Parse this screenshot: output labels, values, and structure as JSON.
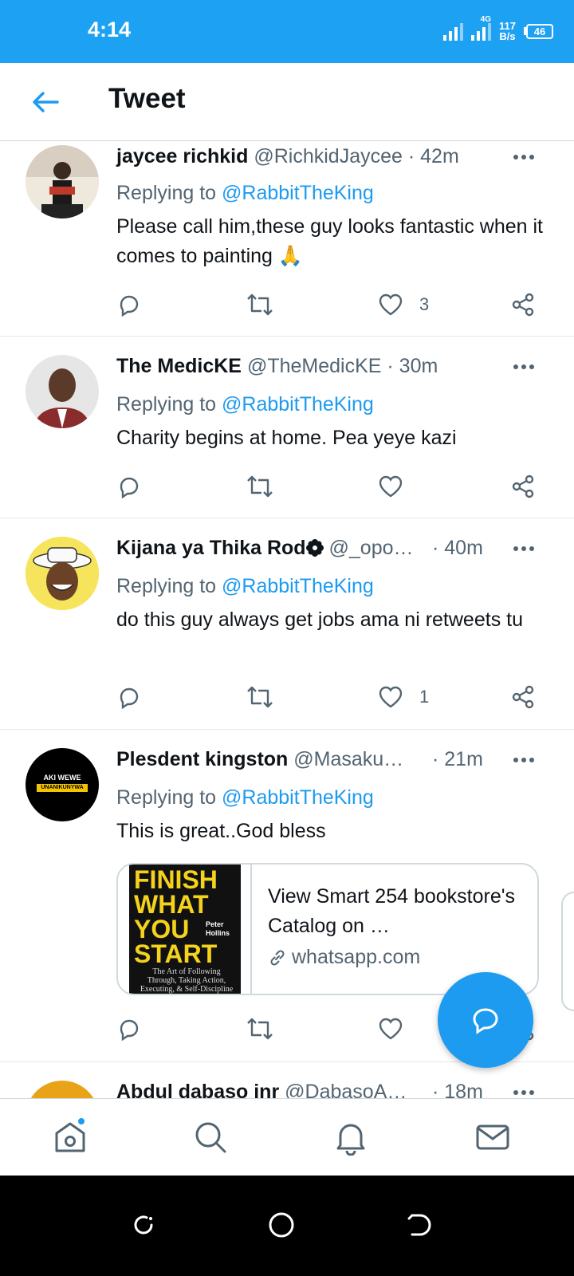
{
  "status_bar": {
    "time": "4:14",
    "network_type": "4G",
    "net_speed_value": "117",
    "net_speed_unit": "B/s",
    "battery": "46"
  },
  "header": {
    "title": "Tweet",
    "back_icon": "arrow-left-icon"
  },
  "colors": {
    "brand": "#1da1f2",
    "link": "#1d9bf0",
    "muted": "#536471",
    "text": "#0f1419"
  },
  "tweets": [
    {
      "name": "jaycee richkid",
      "handle": "@RichkidJaycee",
      "time": "42m",
      "reply_prefix": "Replying to",
      "reply_to": "@RabbitTheKing",
      "text": "Please call him,these guy looks fantastic when it comes to painting 🙏",
      "like_count": "3"
    },
    {
      "name": "The MedicKE",
      "handle": "@TheMedicKE",
      "time": "30m",
      "reply_prefix": "Replying to",
      "reply_to": "@RabbitTheKing",
      "text": "Charity begins at home. Pea yeye kazi",
      "like_count": ""
    },
    {
      "name": "Kijana ya Thika Rod",
      "handle": "@_opo…",
      "time": "40m",
      "reply_prefix": "Replying to",
      "reply_to": "@RabbitTheKing",
      "text": "do this guy always get jobs ama ni retweets tu",
      "like_count": "1"
    },
    {
      "name": "Plesdent kingston",
      "handle": "@Masaku…",
      "time": "21m",
      "reply_prefix": "Replying to",
      "reply_to": "@RabbitTheKing",
      "text": "This is great..God bless",
      "like_count": "",
      "avatar_text_top": "AKI WEWE",
      "avatar_text_bottom": "UNANIKUNYWA",
      "card": {
        "book_lines": [
          "FINISH",
          "WHAT",
          "YOU",
          "START"
        ],
        "book_author": "Peter Hollins",
        "book_subtitle": "The Art of Following Through, Taking Action, Executing, & Self-Discipline",
        "title": "View Smart 254 bookstore's Catalog on …",
        "domain": "whatsapp.com"
      }
    },
    {
      "name": "Abdul dabaso jnr",
      "handle": "@DabasoA…",
      "time": "18m"
    }
  ]
}
